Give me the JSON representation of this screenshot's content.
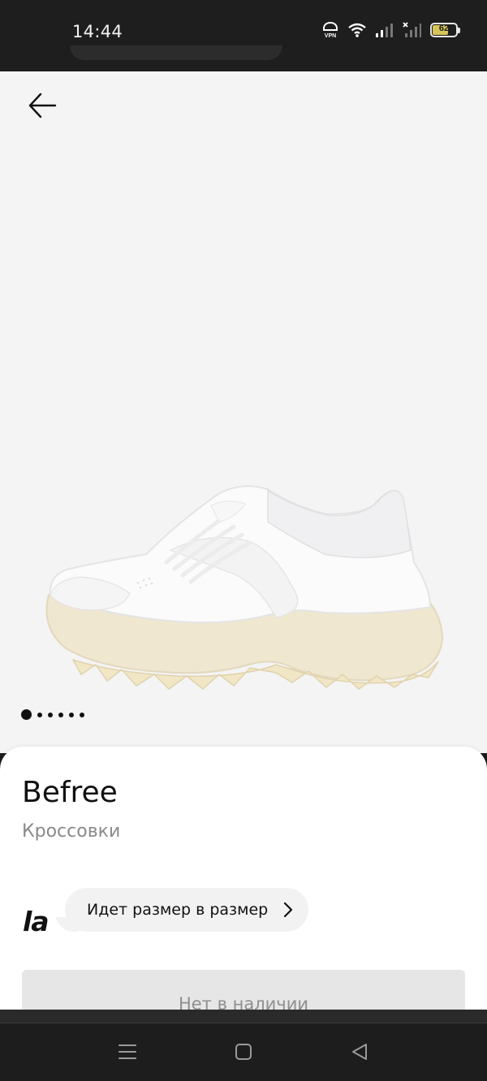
{
  "status_bar": {
    "time": "14:44",
    "vpn_label": "VPN",
    "battery_level": "62",
    "icons": [
      "vpn-icon",
      "wifi-icon",
      "signal-icon",
      "signal-no-service-icon",
      "battery-icon"
    ]
  },
  "product": {
    "brand": "Befree",
    "type": "Кроссовки",
    "image_count": 6,
    "current_image": 1,
    "image_description_icon": "sneaker-image"
  },
  "fit": {
    "logo": "la",
    "text": "Идет размер в размер"
  },
  "stock_button": {
    "label": "Нет в наличии"
  },
  "nav": {
    "icons": [
      "menu-icon",
      "home-icon",
      "back-triangle-icon"
    ]
  },
  "colors": {
    "status_bar_bg": "#1e1e1e",
    "image_bg": "#f4f4f4",
    "card_bg": "#ffffff",
    "secondary_text": "#8a8a8a",
    "disabled_button": "#e6e6e6",
    "battery_accent": "#d6c55a"
  }
}
